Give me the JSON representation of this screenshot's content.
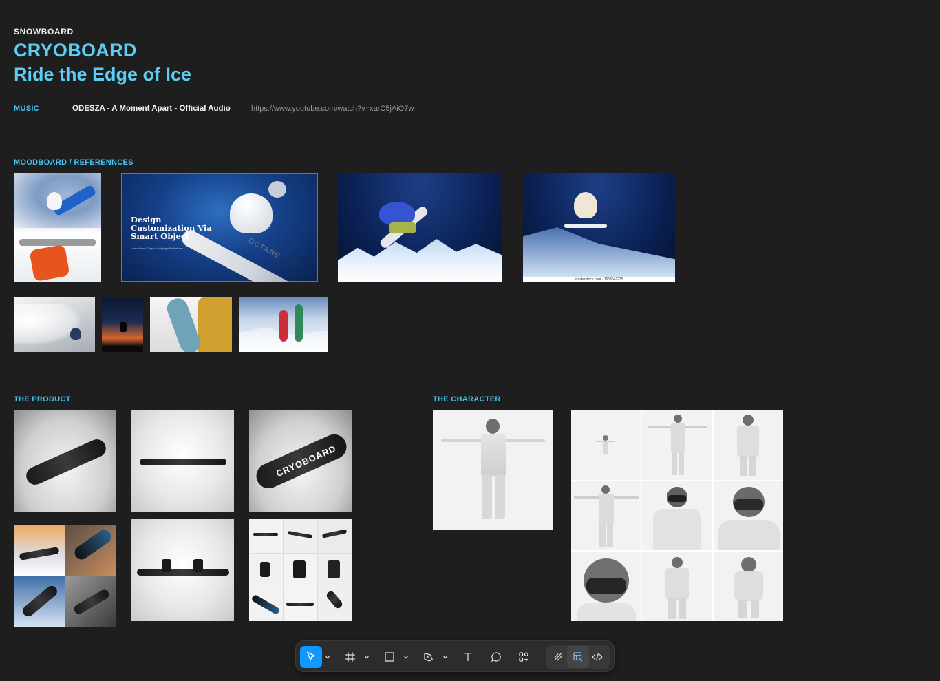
{
  "header": {
    "eyebrow": "SNOWBOARD",
    "title": "CRYOBOARD",
    "tagline": "Ride the Edge of Ice"
  },
  "music": {
    "label": "MUSIC",
    "track": "ODESZA - A Moment Apart - Official Audio",
    "link": "https://www.youtube.com/watch?v=xarC5jAiO7w"
  },
  "moodboard": {
    "label": "MOODBOARD / REFERENNCES",
    "caption_title": "Design Customization Via Smart Object",
    "caption_sub": "Use a Smart Object to highlight its features.",
    "board_print": "OCTANE",
    "watermark": "shutterstock.com · 1653642235"
  },
  "product": {
    "label": "THE PRODUCT",
    "board_print": "CRYOBOARD"
  },
  "character": {
    "label": "THE CHARACTER"
  },
  "toolbar": {
    "tools": [
      "move-tool",
      "frame-tool",
      "shape-tool",
      "pen-tool",
      "text-tool",
      "comment-tool",
      "actions-tool"
    ],
    "modes": [
      "draw-mode",
      "design-mode",
      "dev-mode"
    ],
    "active_tool": "move-tool",
    "active_mode": "design-mode",
    "accent": "#0d99ff"
  },
  "colors": {
    "background": "#1e1e1e",
    "title": "#5ccef5",
    "section_label": "#45c3ef",
    "selection": "#1e8ae0"
  }
}
